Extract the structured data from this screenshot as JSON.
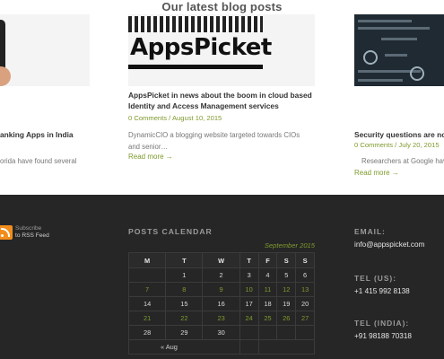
{
  "blog": {
    "heading": "Our latest blog posts",
    "posts": [
      {
        "title": "anking Apps in India",
        "excerpt": "orida have found several"
      },
      {
        "title": "AppsPicket in news about the boom in cloud based Identity and Access Management services",
        "comments": "0 Comments",
        "date": "August 10, 2015",
        "excerpt": "DynamicCIO a blogging website targeted towards CIOs and senior…",
        "read_more": "Read more →",
        "image_text": "AppsPicket"
      },
      {
        "title": "Security questions are no",
        "comments": "0 Comments",
        "date": "July 20, 2015",
        "excerpt": "Researchers at Google hav",
        "read_more": "Read more →"
      }
    ],
    "meta_separator": " / "
  },
  "footer": {
    "rss": {
      "line1": "Subscribe",
      "line2": "to RSS Feed"
    },
    "calendar": {
      "heading": "POSTS CALENDAR",
      "caption": "September 2015",
      "weekdays": [
        "M",
        "T",
        "W",
        "T",
        "F",
        "S",
        "S"
      ],
      "weeks": [
        [
          "1",
          "2",
          "3",
          "4",
          "5",
          "6"
        ],
        [
          "7",
          "8",
          "9",
          "10",
          "11",
          "12",
          "13"
        ],
        [
          "14",
          "15",
          "16",
          "17",
          "18",
          "19",
          "20"
        ],
        [
          "21",
          "22",
          "23",
          "24",
          "25",
          "26",
          "27"
        ],
        [
          "28",
          "29",
          "30",
          "",
          "",
          "",
          ""
        ]
      ],
      "prev_link": "« Aug"
    },
    "contact": {
      "email_label": "EMAIL:",
      "email": "info@appspicket.com",
      "tel_us_label": "TEL (US):",
      "tel_us": "+1 415 992 8138",
      "tel_india_label": "TEL (INDIA):",
      "tel_india": "+91 98188 70318"
    }
  },
  "colors": {
    "accent": "#7f9a2e",
    "footer_bg": "#262626",
    "rss": "#f28d1b"
  }
}
